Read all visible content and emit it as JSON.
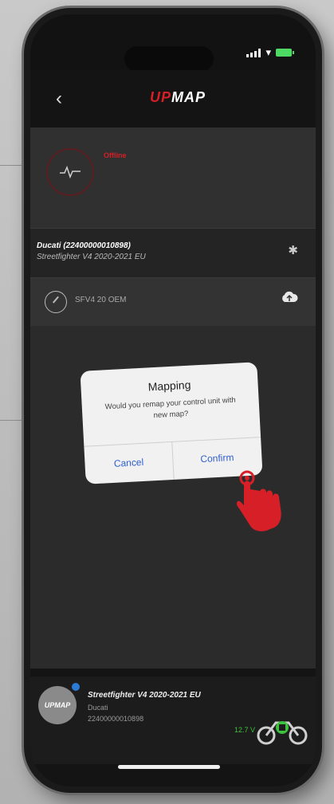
{
  "header": {
    "logo_prefix": "UP",
    "logo_suffix": "MAP",
    "back_icon": "chevron-left-icon"
  },
  "status_card": {
    "state_label": "Offline",
    "icon": "heartbeat-icon"
  },
  "ecu": {
    "brand_serial": "Ducati (22400000010898)",
    "model": "Streetfighter V4 2020-2021 EU",
    "connection_icon": "bluetooth-icon"
  },
  "map": {
    "name": "SFV4 20 OEM",
    "icon": "speedometer-icon",
    "action_icon": "cloud-upload-icon"
  },
  "dialog": {
    "title": "Mapping",
    "message": "Would you remap your control unit with new map?",
    "cancel_label": "Cancel",
    "confirm_label": "Confirm"
  },
  "vehicle": {
    "model": "Streetfighter V4 2020-2021 EU",
    "brand": "Ducati",
    "serial": "22400000010898",
    "voltage": "12.7 V",
    "app_logo_text": "UPMAP"
  },
  "colors": {
    "accent_red": "#d61f26",
    "dialog_button_blue": "#2f5fd0",
    "battery_green": "#3cc23c"
  }
}
